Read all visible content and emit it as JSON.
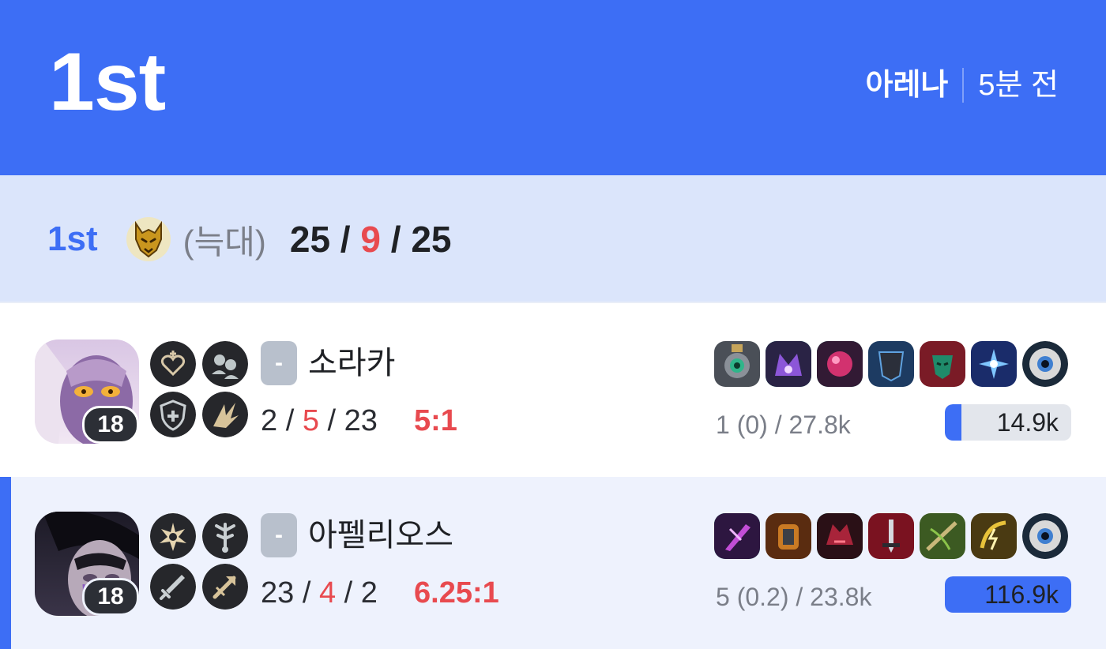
{
  "header": {
    "rank": "1st",
    "mode": "아레나",
    "time_ago": "5분 전",
    "accent": "#3d6ef5"
  },
  "team": {
    "rank": "1st",
    "badge_icon": "wolf-team-icon",
    "name": "(늑대)",
    "kills": "25",
    "sep1": " / ",
    "deaths": "9",
    "sep2": " / ",
    "assists": "25"
  },
  "players": [
    {
      "champion": "소라카",
      "level": "18",
      "tier": "-",
      "kills": "2",
      "deaths": "5",
      "assists": "23",
      "kda_ratio": "5:1",
      "cs": "1 (0) / 27.8k",
      "damage": "14.9k",
      "damage_fraction": 0.13,
      "spells": [
        "heart-augment-icon",
        "people-augment-icon",
        "shield-augment-icon",
        "burst-augment-icon"
      ],
      "items": [
        "gear-item-icon",
        "violet-crown-item-icon",
        "pink-orb-item-icon",
        "dark-armor-item-icon",
        "green-mask-item-icon",
        "blue-star-item-icon",
        "eye-ward-icon"
      ]
    },
    {
      "champion": "아펠리오스",
      "level": "18",
      "tier": "-",
      "kills": "23",
      "deaths": "4",
      "assists": "2",
      "kda_ratio": "6.25:1",
      "cs": "5 (0.2) / 23.8k",
      "damage": "116.9k",
      "damage_fraction": 1.0,
      "spells": [
        "star-burst-augment-icon",
        "tree-augment-icon",
        "sword-augment-icon",
        "arrow-augment-icon"
      ],
      "items": [
        "violet-blade-item-icon",
        "golden-gauntlet-item-icon",
        "red-helm-item-icon",
        "crimson-blade-item-icon",
        "crossbow-item-icon",
        "lightning-bow-item-icon",
        "eye-ward-icon"
      ]
    }
  ]
}
